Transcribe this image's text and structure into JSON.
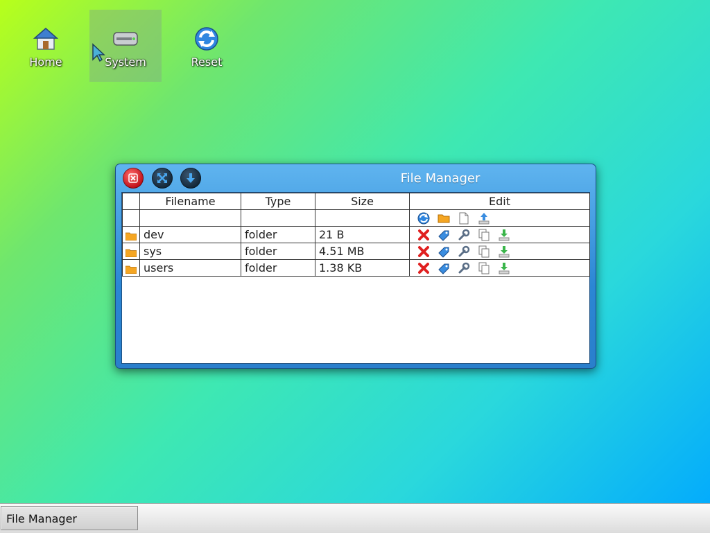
{
  "desktop": {
    "icons": [
      {
        "label": "Home",
        "icon": "home-icon"
      },
      {
        "label": "System",
        "icon": "drive-icon",
        "selected": true
      },
      {
        "label": "Reset",
        "icon": "reset-icon"
      }
    ]
  },
  "window": {
    "title": "File Manager",
    "buttons": [
      "close-icon",
      "maximize-icon",
      "minimize-icon"
    ],
    "table": {
      "headers": {
        "filename": "Filename",
        "type": "Type",
        "size": "Size",
        "edit": "Edit"
      },
      "toolbar_icons": [
        "refresh-icon",
        "new-folder-icon",
        "new-file-icon",
        "upload-icon"
      ],
      "rows": [
        {
          "filename": "dev",
          "type": "folder",
          "size": "21 B"
        },
        {
          "filename": "sys",
          "type": "folder",
          "size": "4.51 MB"
        },
        {
          "filename": "users",
          "type": "folder",
          "size": "1.38 KB"
        }
      ],
      "row_actions": [
        "delete-icon",
        "rename-icon",
        "properties-icon",
        "copy-icon",
        "download-icon"
      ]
    }
  },
  "taskbar": {
    "items": [
      {
        "label": "File Manager"
      }
    ]
  },
  "colors": {
    "window_blue": "#2b86d4",
    "close_red": "#c0101a",
    "folder_orange": "#f5a623"
  }
}
